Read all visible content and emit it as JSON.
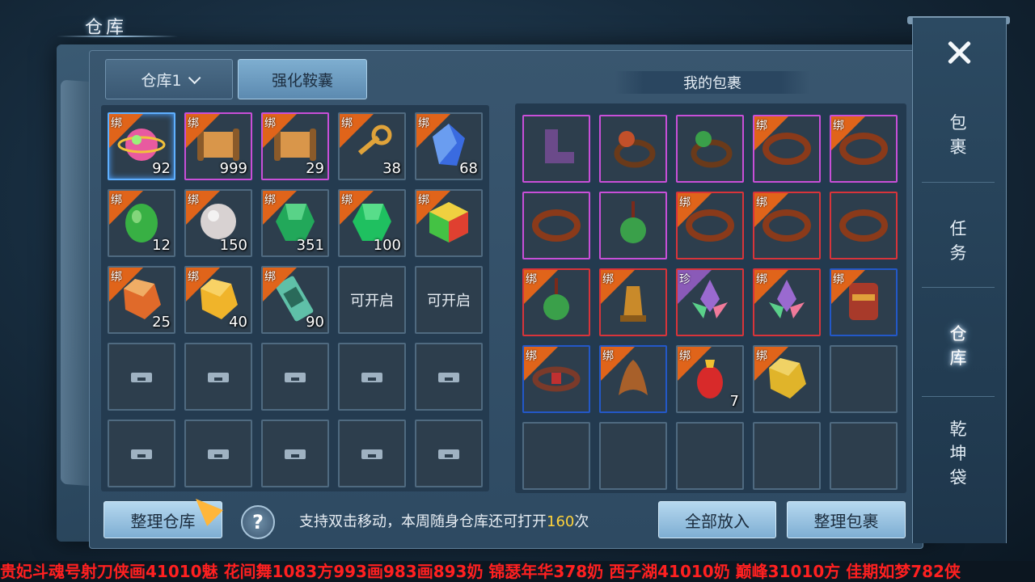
{
  "window": {
    "title": "仓库"
  },
  "tabs": {
    "storage_select": "仓库1",
    "upgrade": "强化鞍囊"
  },
  "bag": {
    "title": "我的包裹"
  },
  "bind_label": "绑",
  "rare_label": "珍",
  "warehouse_slots": [
    {
      "q": "sel",
      "bind": true,
      "count": "92",
      "icon": "orb",
      "color": "#e85aa0"
    },
    {
      "q": "purple",
      "bind": true,
      "count": "999",
      "icon": "scroll",
      "color": "#d9964a"
    },
    {
      "q": "purple",
      "bind": true,
      "count": "29",
      "icon": "scroll",
      "color": "#d9964a"
    },
    {
      "q": "none",
      "bind": true,
      "count": "38",
      "icon": "key",
      "color": "#e0a33a"
    },
    {
      "q": "none",
      "bind": true,
      "count": "68",
      "icon": "crystal",
      "color": "#3a6be0"
    },
    {
      "q": "none",
      "bind": true,
      "count": "12",
      "icon": "jade",
      "color": "#38b044"
    },
    {
      "q": "none",
      "bind": true,
      "count": "150",
      "icon": "pearl",
      "color": "#d8d2d2"
    },
    {
      "q": "none",
      "bind": true,
      "count": "351",
      "icon": "emerald",
      "color": "#22a85a"
    },
    {
      "q": "none",
      "bind": true,
      "count": "100",
      "icon": "emerald",
      "color": "#1fc060"
    },
    {
      "q": "none",
      "bind": true,
      "count": "",
      "icon": "cube",
      "color": "#44c244"
    },
    {
      "q": "none",
      "bind": true,
      "count": "25",
      "icon": "amber",
      "color": "#e06a2a"
    },
    {
      "q": "none",
      "bind": true,
      "count": "40",
      "icon": "amber",
      "color": "#f0b42a"
    },
    {
      "q": "none",
      "bind": true,
      "count": "90",
      "icon": "talisman",
      "color": "#5fc0a8"
    },
    {
      "q": "none",
      "bind": false,
      "count": "",
      "text": "可开启"
    },
    {
      "q": "none",
      "bind": false,
      "count": "",
      "text": "可开启"
    },
    {
      "q": "none",
      "locked": true
    },
    {
      "q": "none",
      "locked": true
    },
    {
      "q": "none",
      "locked": true
    },
    {
      "q": "none",
      "locked": true
    },
    {
      "q": "none",
      "locked": true
    },
    {
      "q": "none",
      "locked": true
    },
    {
      "q": "none",
      "locked": true
    },
    {
      "q": "none",
      "locked": true
    },
    {
      "q": "none",
      "locked": true
    },
    {
      "q": "none",
      "locked": true
    }
  ],
  "bag_slots": [
    {
      "q": "purple",
      "bind": false,
      "icon": "boots",
      "color": "#6b4a8a"
    },
    {
      "q": "purple",
      "bind": false,
      "icon": "ring",
      "color": "#c2502a"
    },
    {
      "q": "purple",
      "bind": false,
      "icon": "ring",
      "color": "#3aa04a"
    },
    {
      "q": "purple",
      "bind": true,
      "icon": "band",
      "color": "#8a3a1a"
    },
    {
      "q": "purple",
      "bind": true,
      "icon": "band",
      "color": "#8a3a1a"
    },
    {
      "q": "purple",
      "bind": false,
      "icon": "band",
      "color": "#8a3a1a"
    },
    {
      "q": "purple",
      "bind": false,
      "icon": "pendant",
      "color": "#3aa04a"
    },
    {
      "q": "red",
      "bind": true,
      "icon": "band",
      "color": "#8a3a1a"
    },
    {
      "q": "red",
      "bind": true,
      "icon": "band",
      "color": "#8a3a1a"
    },
    {
      "q": "red",
      "bind": false,
      "icon": "band",
      "color": "#8a3a1a"
    },
    {
      "q": "red",
      "bind": true,
      "icon": "pendant",
      "color": "#3aa04a"
    },
    {
      "q": "red",
      "bind": true,
      "icon": "bell",
      "color": "#c98a2a"
    },
    {
      "q": "red",
      "bind": "rare",
      "icon": "lotus",
      "color": "#9a6ad0"
    },
    {
      "q": "red",
      "bind": true,
      "icon": "lotus",
      "color": "#9a6ad0"
    },
    {
      "q": "darkblue",
      "bind": true,
      "icon": "bracer",
      "color": "#a83a2a"
    },
    {
      "q": "darkblue",
      "bind": true,
      "icon": "belt",
      "color": "#7a3a2a"
    },
    {
      "q": "darkblue",
      "bind": true,
      "icon": "claw",
      "color": "#a8602a"
    },
    {
      "q": "none",
      "bind": true,
      "count": "7",
      "icon": "ruby",
      "color": "#d82a2a"
    },
    {
      "q": "none",
      "bind": true,
      "icon": "amber",
      "color": "#e0b42a"
    },
    {
      "q": "none"
    },
    {
      "q": "none"
    },
    {
      "q": "none"
    },
    {
      "q": "none"
    },
    {
      "q": "none"
    },
    {
      "q": "none"
    }
  ],
  "footer": {
    "sort_storage": "整理仓库",
    "help": "?",
    "note_prefix": "支持双击移动，本周随身仓库还可打开",
    "note_count": "160",
    "note_suffix": "次",
    "put_all": "全部放入",
    "sort_bag": "整理包裹"
  },
  "side_nav": {
    "bag": "包裹",
    "quest": "任务",
    "storage": "仓库",
    "qiankun": "乾坤袋"
  },
  "ticker": "贵妃斗魂号射刀侠画41010魅  花间舞1083方993画983画893奶  锦瑟年华378奶  西子湖41010奶  巅峰31010方  佳期如梦782侠"
}
